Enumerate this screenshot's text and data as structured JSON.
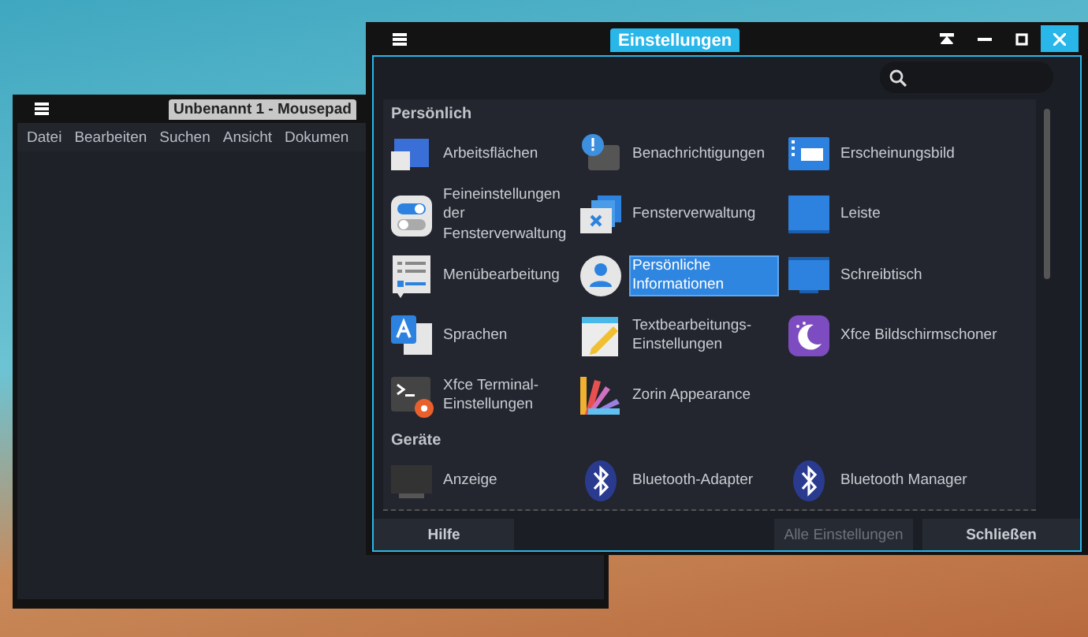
{
  "mousepad": {
    "title": "Unbenannt 1 - Mousepad",
    "menu": [
      "Datei",
      "Bearbeiten",
      "Suchen",
      "Ansicht",
      "Dokumen"
    ]
  },
  "settings": {
    "title": "Einstellungen",
    "sections": [
      {
        "title": "Persönlich",
        "items": [
          {
            "kind": "workspaces",
            "label": "Arbeitsflächen",
            "selected": false
          },
          {
            "kind": "notifications",
            "label": "Benachrichtigungen",
            "selected": false
          },
          {
            "kind": "appearance",
            "label": "Erscheinungsbild",
            "selected": false
          },
          {
            "kind": "tweaks",
            "label": "Feineinstellungen der Fensterverwaltung",
            "selected": false
          },
          {
            "kind": "windows",
            "label": "Fensterverwaltung",
            "selected": false
          },
          {
            "kind": "panel",
            "label": "Leiste",
            "selected": false
          },
          {
            "kind": "menu",
            "label": "Menübearbeitung",
            "selected": false
          },
          {
            "kind": "person",
            "label": "Persönliche Informationen",
            "selected": true
          },
          {
            "kind": "desktop",
            "label": "Schreibtisch",
            "selected": false
          },
          {
            "kind": "language",
            "label": "Sprachen",
            "selected": false
          },
          {
            "kind": "editor",
            "label": "Textbearbeitungs-Einstellungen",
            "selected": false
          },
          {
            "kind": "screensaver",
            "label": "Xfce Bildschirmschoner",
            "selected": false
          },
          {
            "kind": "terminal",
            "label": "Xfce Terminal-Einstellungen",
            "selected": false
          },
          {
            "kind": "palette",
            "label": "Zorin Appearance",
            "selected": false
          }
        ]
      },
      {
        "title": "Geräte",
        "items": [
          {
            "kind": "display",
            "label": "Anzeige",
            "selected": false
          },
          {
            "kind": "bluetooth",
            "label": "Bluetooth-Adapter",
            "selected": false
          },
          {
            "kind": "bluetooth",
            "label": "Bluetooth Manager",
            "selected": false
          }
        ]
      }
    ],
    "buttons": [
      {
        "label": "Hilfe",
        "disabled": false
      },
      {
        "label": "Alle Einstellungen",
        "disabled": true
      },
      {
        "label": "Schließen",
        "disabled": false
      }
    ]
  }
}
